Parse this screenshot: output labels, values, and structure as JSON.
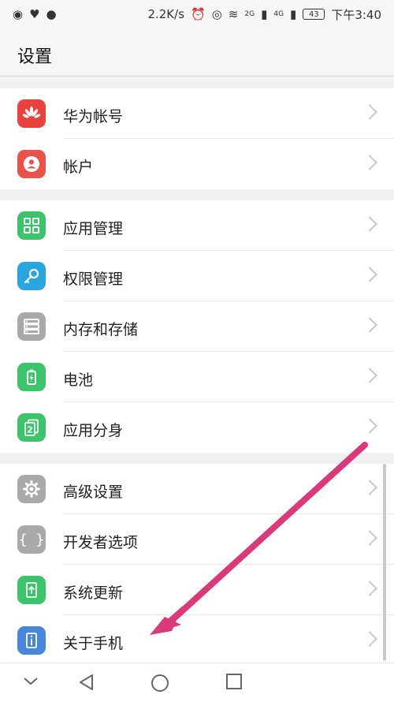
{
  "status_bar": {
    "speed": "2.2K/s",
    "net1": "2G",
    "net2": "4G",
    "battery": "43",
    "time": "下午3:40"
  },
  "header": {
    "title": "设置"
  },
  "groups": [
    {
      "items": [
        {
          "label": "华为帐号",
          "icon": "huawei-icon",
          "color": "#e8423f"
        },
        {
          "label": "帐户",
          "icon": "account-icon",
          "color": "#e8534b"
        }
      ]
    },
    {
      "items": [
        {
          "label": "应用管理",
          "icon": "apps-icon",
          "color": "#3cc36b"
        },
        {
          "label": "权限管理",
          "icon": "key-icon",
          "color": "#2aa6de"
        },
        {
          "label": "内存和存储",
          "icon": "storage-icon",
          "color": "#a9a9a9"
        },
        {
          "label": "电池",
          "icon": "battery-icon",
          "color": "#3cc36b"
        },
        {
          "label": "应用分身",
          "icon": "app-twin-icon",
          "color": "#3cc36b"
        }
      ]
    },
    {
      "items": [
        {
          "label": "高级设置",
          "icon": "gear-icon",
          "color": "#a9a9a9"
        },
        {
          "label": "开发者选项",
          "icon": "braces-icon",
          "color": "#a9a9a9"
        },
        {
          "label": "系统更新",
          "icon": "update-icon",
          "color": "#3cc36b"
        },
        {
          "label": "关于手机",
          "icon": "info-icon",
          "color": "#4a86d8"
        }
      ]
    }
  ],
  "annotation_color": "#d93a7a"
}
